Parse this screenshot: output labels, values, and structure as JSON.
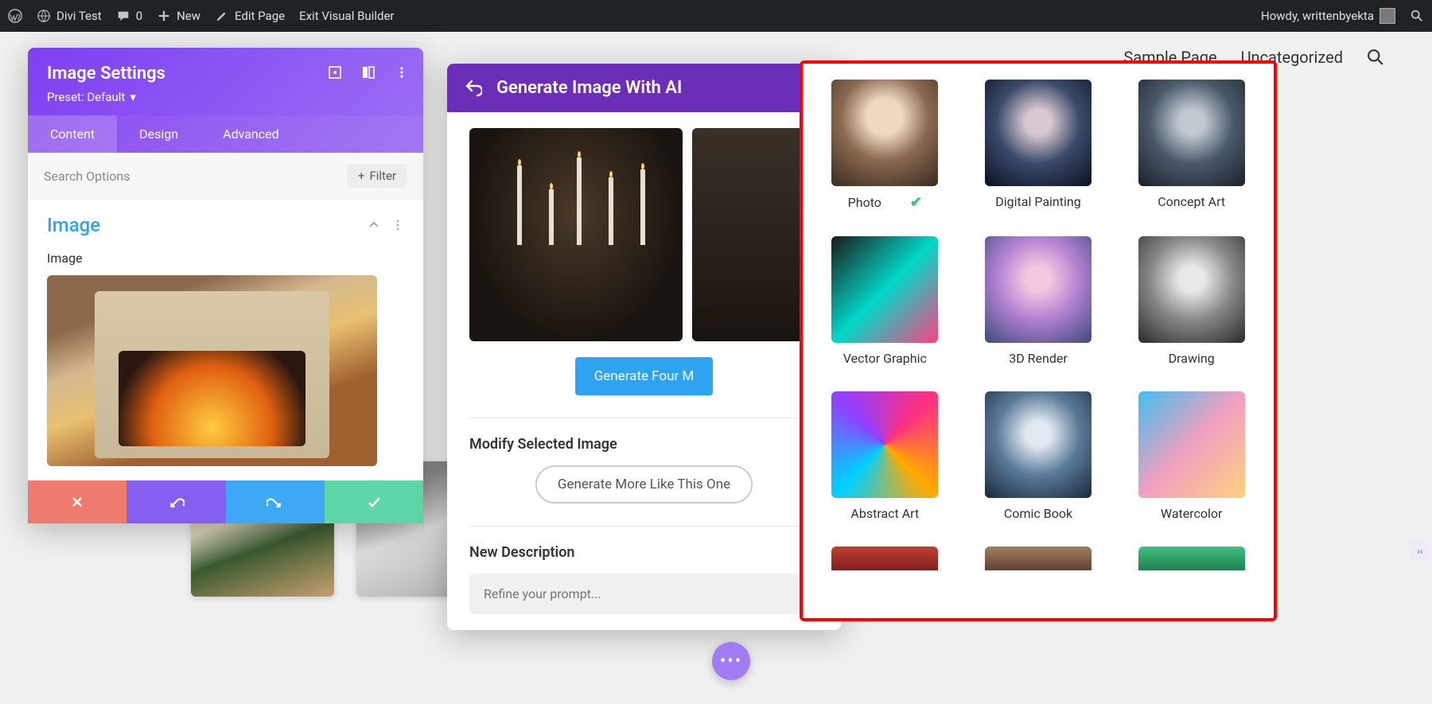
{
  "wp_bar": {
    "site_name": "Divi Test",
    "comments": "0",
    "new": "New",
    "edit_page": "Edit Page",
    "exit_vb": "Exit Visual Builder",
    "howdy": "Howdy, writtenbyekta"
  },
  "page_nav": {
    "sample": "Sample Page",
    "uncat": "Uncategorized"
  },
  "settings": {
    "title": "Image Settings",
    "preset": "Preset: Default",
    "tabs": {
      "content": "Content",
      "design": "Design",
      "advanced": "Advanced"
    },
    "search_placeholder": "Search Options",
    "filter": "Filter",
    "section_title": "Image",
    "field_label": "Image"
  },
  "ai": {
    "title": "Generate Image With AI",
    "generate_four": "Generate Four M",
    "modify_heading": "Modify Selected Image",
    "more_like": "Generate More Like This One",
    "new_desc": "New Description",
    "refine_placeholder": "Refine your prompt..."
  },
  "styles": [
    {
      "key": "photo",
      "label": "Photo",
      "selected": true
    },
    {
      "key": "digital",
      "label": "Digital Painting",
      "selected": false
    },
    {
      "key": "concept",
      "label": "Concept Art",
      "selected": false
    },
    {
      "key": "vector",
      "label": "Vector Graphic",
      "selected": false
    },
    {
      "key": "3d",
      "label": "3D Render",
      "selected": false
    },
    {
      "key": "drawing",
      "label": "Drawing",
      "selected": false
    },
    {
      "key": "abstract",
      "label": "Abstract Art",
      "selected": false
    },
    {
      "key": "comic",
      "label": "Comic Book",
      "selected": false
    },
    {
      "key": "water",
      "label": "Watercolor",
      "selected": false
    }
  ]
}
